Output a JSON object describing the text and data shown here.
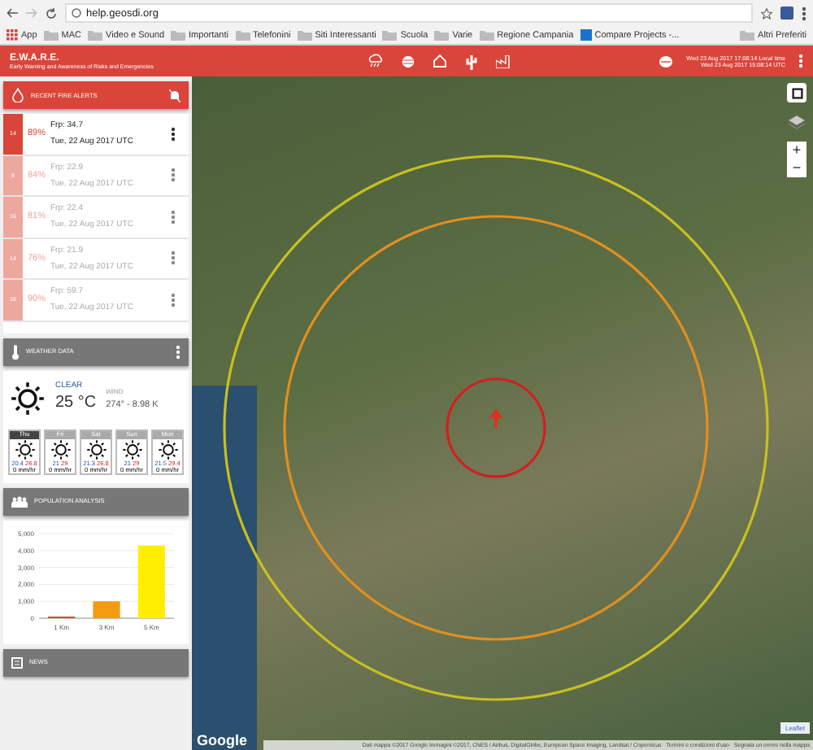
{
  "browser": {
    "url": "help.geosdi.org",
    "bookmarks": [
      {
        "label": "App",
        "kind": "apps"
      },
      {
        "label": "MAC",
        "kind": "folder"
      },
      {
        "label": "Video e Sound",
        "kind": "folder"
      },
      {
        "label": "Importanti",
        "kind": "folder"
      },
      {
        "label": "Telefonini",
        "kind": "folder"
      },
      {
        "label": "Siti Interessanti",
        "kind": "folder"
      },
      {
        "label": "Scuola",
        "kind": "folder"
      },
      {
        "label": "Varie",
        "kind": "folder"
      },
      {
        "label": "Regione Campania",
        "kind": "folder"
      },
      {
        "label": "Compare Projects -...",
        "kind": "site"
      }
    ],
    "other_bookmarks": "Altri Preferiti"
  },
  "header": {
    "title": "E.W.A.R.E.",
    "subtitle": "Early Warning and Awareness of Risks and Emergencies",
    "local_time": "Wed 23 Aug 2017 17:08:14 Local time",
    "utc_time": "Wed 23 Aug 2017 15:08:14 UTC"
  },
  "fire_alerts": {
    "title": "RECENT FIRE ALERTS",
    "items": [
      {
        "number": "14",
        "confidence": "89%",
        "frp": "Frp: 34.7",
        "date": "Tue, 22 Aug 2017 UTC",
        "selected": true
      },
      {
        "number": "9",
        "confidence": "84%",
        "frp": "Frp: 22.9",
        "date": "Tue, 22 Aug 2017 UTC",
        "selected": false
      },
      {
        "number": "16",
        "confidence": "81%",
        "frp": "Frp: 22.4",
        "date": "Tue, 22 Aug 2017 UTC",
        "selected": false
      },
      {
        "number": "14",
        "confidence": "76%",
        "frp": "Frp: 21.9",
        "date": "Tue, 22 Aug 2017 UTC",
        "selected": false
      },
      {
        "number": "16",
        "confidence": "90%",
        "frp": "Frp: 59.7",
        "date": "Tue, 22 Aug 2017 UTC",
        "selected": false
      }
    ]
  },
  "weather": {
    "title": "WEATHER DATA",
    "condition": "CLEAR",
    "temperature": "25 °C",
    "wind_label": "WIND",
    "wind": "274° - 8.98 K",
    "forecast": [
      {
        "day": "Thu",
        "min": "20.4",
        "max": "26.8",
        "rain": "0 mm/hr",
        "selected": true
      },
      {
        "day": "Fri",
        "min": "21",
        "max": "29",
        "rain": "0 mm/hr",
        "selected": false
      },
      {
        "day": "Sat",
        "min": "21.3",
        "max": "26.8",
        "rain": "0 mm/hr",
        "selected": false
      },
      {
        "day": "Sun",
        "min": "21",
        "max": "29",
        "rain": "0 mm/hr",
        "selected": false
      },
      {
        "day": "Mon",
        "min": "21.5",
        "max": "29.4",
        "rain": "0 mm/hr",
        "selected": false
      }
    ]
  },
  "population": {
    "title": "POPULATION ANALYSIS",
    "chart_data": {
      "type": "bar",
      "categories": [
        "1 Km",
        "3 Km",
        "5 Km"
      ],
      "grid": true,
      "values": [
        100,
        1000,
        4300
      ],
      "colors": [
        "#d84a38",
        "#f39c12",
        "#ffee00"
      ],
      "ylim": [
        0,
        5000
      ],
      "yticks": [
        {
          "value": 0,
          "label": "0"
        },
        {
          "value": 1000,
          "label": "1,000"
        },
        {
          "value": 2000,
          "label": "2,000"
        },
        {
          "value": 3000,
          "label": "3,000"
        },
        {
          "value": 4000,
          "label": "4,000"
        },
        {
          "value": 5000,
          "label": "5,000"
        }
      ]
    }
  },
  "news": {
    "title": "NEWS"
  },
  "map": {
    "zoom_in": "+",
    "zoom_out": "−",
    "google": "Google",
    "attribution": "Dati mappa ©2017 Google Immagini ©2017, CNES / Airbus, DigitalGlobe, European Space Imaging, Landsat / Copernicus",
    "terms": "Termini e condizioni d'uso",
    "report": "Segnala un errore nella mappa",
    "leaflet": "Leaflet",
    "rings": [
      {
        "color": "#c8c020"
      },
      {
        "color": "#e09020"
      },
      {
        "color": "#d02020"
      }
    ]
  }
}
